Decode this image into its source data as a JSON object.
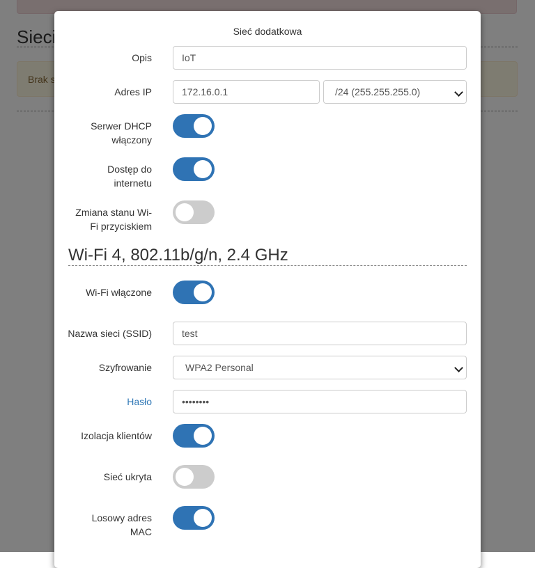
{
  "background": {
    "title": "Sieci",
    "alert_text": "Brak s"
  },
  "modal": {
    "title": "Sieć dodatkowa",
    "opis": {
      "label": "Opis",
      "value": "IoT"
    },
    "adres_ip": {
      "label": "Adres IP",
      "value": "172.16.0.1",
      "mask": "/24 (255.255.255.0)"
    },
    "dhcp": {
      "label_1": "Serwer DHCP",
      "label_2": "włączony",
      "on": true
    },
    "internet": {
      "label_1": "Dostęp do",
      "label_2": "internetu",
      "on": true
    },
    "wifi_button": {
      "label_1": "Zmiana stanu Wi-",
      "label_2": "Fi przyciskiem",
      "on": false
    },
    "section_title": "Wi-Fi 4, 802.11b/g/n, 2.4 GHz",
    "wifi_enabled": {
      "label": "Wi-Fi włączone",
      "on": true
    },
    "ssid": {
      "label": "Nazwa sieci (SSID)",
      "value": "test"
    },
    "encryption": {
      "label": "Szyfrowanie",
      "value": "WPA2 Personal"
    },
    "password": {
      "label": "Hasło",
      "value": "••••••••"
    },
    "isolation": {
      "label": "Izolacja klientów",
      "on": true
    },
    "hidden": {
      "label": "Sieć ukryta",
      "on": false
    },
    "random_mac": {
      "label_1": "Losowy adres",
      "label_2": "MAC",
      "on": true
    }
  },
  "colors": {
    "toggle_on": "#2f73b4",
    "toggle_off": "#cccccc",
    "link": "#337ab7"
  }
}
